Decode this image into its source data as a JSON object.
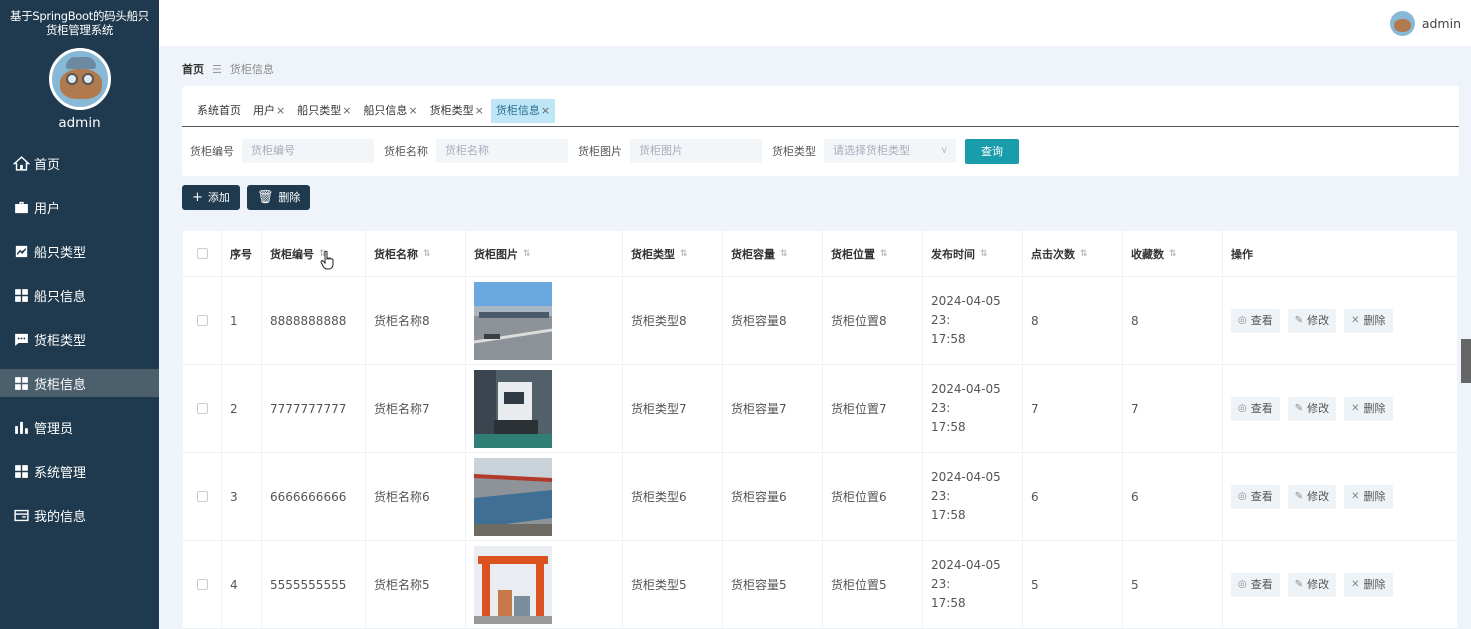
{
  "sidebar": {
    "app_title_line1": "基于SpringBoot的码头船只",
    "app_title_line2": "货柜管理系统",
    "username": "admin",
    "items": [
      {
        "label": "首页"
      },
      {
        "label": "用户"
      },
      {
        "label": "船只类型"
      },
      {
        "label": "船只信息"
      },
      {
        "label": "货柜类型"
      },
      {
        "label": "货柜信息"
      },
      {
        "label": "管理员"
      },
      {
        "label": "系统管理"
      },
      {
        "label": "我的信息"
      }
    ]
  },
  "topbar": {
    "username": "admin"
  },
  "breadcrumb": {
    "home": "首页",
    "separator": "☰",
    "current": "货柜信息"
  },
  "tabs": [
    {
      "label": "系统首页",
      "close": ""
    },
    {
      "label": "用户",
      "close": "×"
    },
    {
      "label": "船只类型",
      "close": "×"
    },
    {
      "label": "船只信息",
      "close": "×"
    },
    {
      "label": "货柜类型",
      "close": "×"
    },
    {
      "label": "货柜信息",
      "close": "×"
    }
  ],
  "filters": {
    "code_label": "货柜编号",
    "code_placeholder": "货柜编号",
    "name_label": "货柜名称",
    "name_placeholder": "货柜名称",
    "image_label": "货柜图片",
    "image_placeholder": "货柜图片",
    "type_label": "货柜类型",
    "type_placeholder": "请选择货柜类型",
    "query_label": "查询"
  },
  "actions": {
    "add_label": "添加",
    "delete_label": "删除"
  },
  "table": {
    "headers": [
      "序号",
      "货柜编号",
      "货柜名称",
      "货柜图片",
      "货柜类型",
      "货柜容量",
      "货柜位置",
      "发布时间",
      "点击次数",
      "收藏数",
      "操作"
    ],
    "ops": {
      "view": "查看",
      "edit": "修改",
      "delete": "删除"
    },
    "rows": [
      {
        "index": "1",
        "code": "8888888888",
        "name": "货柜名称8",
        "type": "货柜类型8",
        "capacity": "货柜容量8",
        "location": "货柜位置8",
        "time1": "2024-04-05 23:",
        "time2": "17:58",
        "clicks": "8",
        "favs": "8"
      },
      {
        "index": "2",
        "code": "7777777777",
        "name": "货柜名称7",
        "type": "货柜类型7",
        "capacity": "货柜容量7",
        "location": "货柜位置7",
        "time1": "2024-04-05 23:",
        "time2": "17:58",
        "clicks": "7",
        "favs": "7"
      },
      {
        "index": "3",
        "code": "6666666666",
        "name": "货柜名称6",
        "type": "货柜类型6",
        "capacity": "货柜容量6",
        "location": "货柜位置6",
        "time1": "2024-04-05 23:",
        "time2": "17:58",
        "clicks": "6",
        "favs": "6"
      },
      {
        "index": "4",
        "code": "5555555555",
        "name": "货柜名称5",
        "type": "货柜类型5",
        "capacity": "货柜容量5",
        "location": "货柜位置5",
        "time1": "2024-04-05 23:",
        "time2": "17:58",
        "clicks": "5",
        "favs": "5"
      }
    ]
  },
  "colors": {
    "sidebar": "#1f3a4e",
    "accent": "#1a9dab",
    "active_tab": "#bfe6f7"
  }
}
